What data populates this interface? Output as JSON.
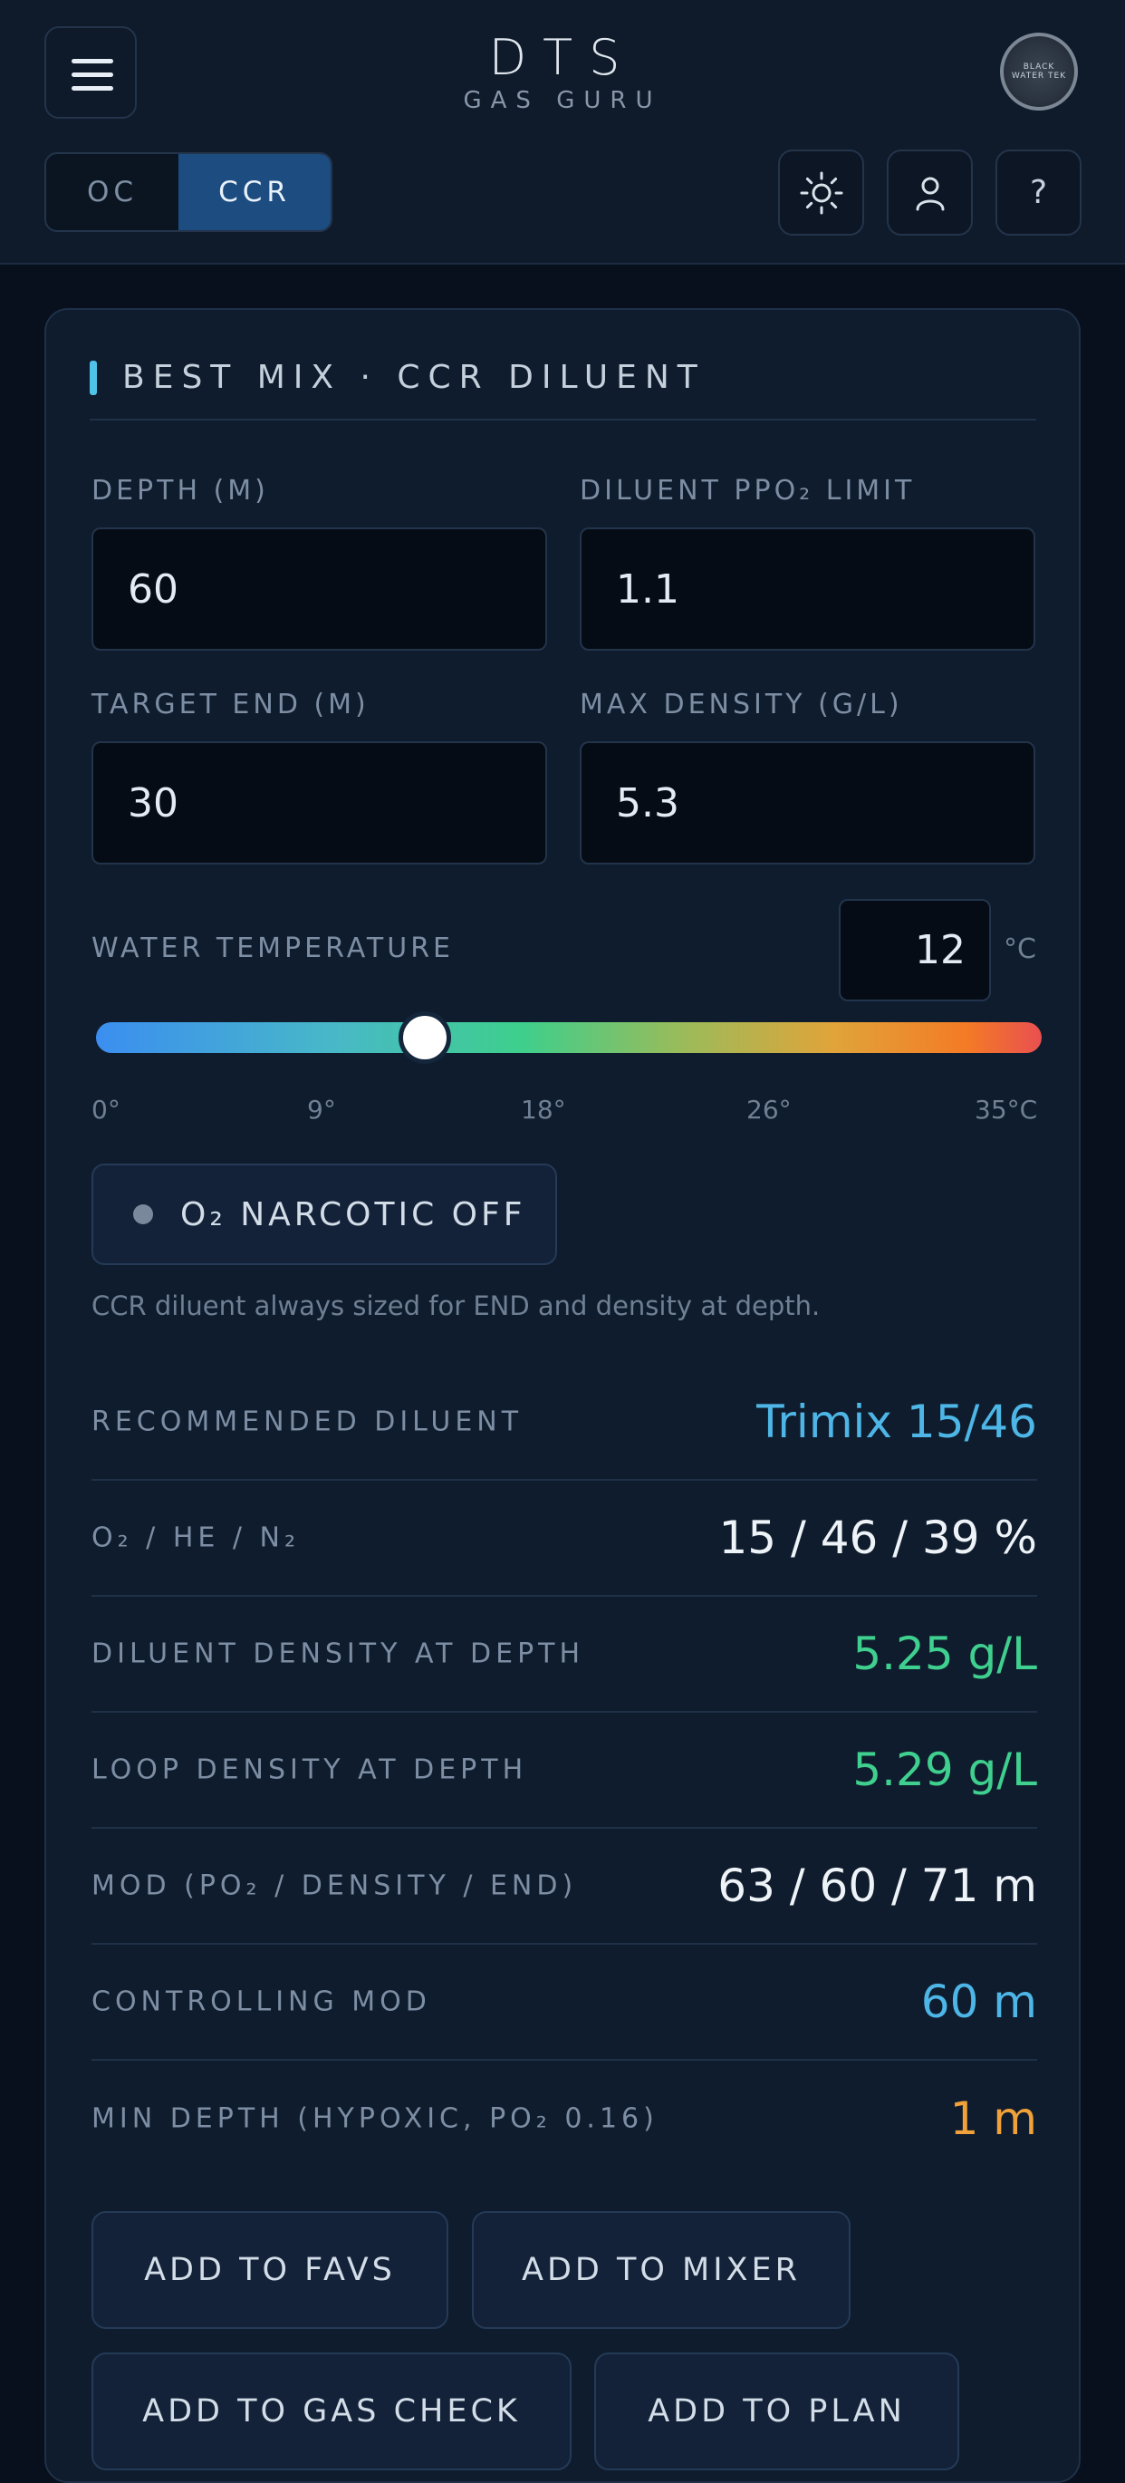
{
  "header": {
    "title": "DTS",
    "subtitle": "GAS GURU",
    "logo_text": "BLACK WATER TEK",
    "modes": [
      "OC",
      "CCR"
    ],
    "active_mode": "CCR",
    "help_label": "?"
  },
  "card": {
    "title": "BEST MIX · CCR DILUENT",
    "fields": {
      "depth": {
        "label": "DEPTH (M)",
        "value": "60"
      },
      "ppo2_limit": {
        "label": "DILUENT PPO₂ LIMIT",
        "value": "1.1"
      },
      "target_end": {
        "label": "TARGET END (M)",
        "value": "30"
      },
      "max_density": {
        "label": "MAX DENSITY (G/L)",
        "value": "5.3"
      }
    },
    "temperature": {
      "label": "WATER TEMPERATURE",
      "value": "12",
      "unit": "°C",
      "min": 0,
      "max": 35,
      "ticks": [
        "0°",
        "9°",
        "18°",
        "26°",
        "35°C"
      ]
    },
    "narcotic_toggle": "O₂ NARCOTIC OFF",
    "note": "CCR diluent always sized for END and density at depth.",
    "results": [
      {
        "label": "RECOMMENDED DILUENT",
        "value": "Trimix 15/46",
        "color": "#4db6e6"
      },
      {
        "label": "O₂ / HE / N₂",
        "value": "15 / 46 / 39 %",
        "color": "#eef3f8"
      },
      {
        "label": "DILUENT DENSITY AT DEPTH",
        "value": "5.25 g/L",
        "color": "#3fcf8e"
      },
      {
        "label": "LOOP DENSITY AT DEPTH",
        "value": "5.29 g/L",
        "color": "#3fcf8e"
      },
      {
        "label": "MOD (PO₂ / DENSITY / END)",
        "value": "63 / 60 / 71 m",
        "color": "#eef3f8"
      },
      {
        "label": "CONTROLLING MOD",
        "value": "60 m",
        "color": "#4db6e6"
      },
      {
        "label": "MIN DEPTH (HYPOXIC, PO₂ 0.16)",
        "value": "1 m",
        "color": "#f0a13a"
      }
    ],
    "actions": {
      "add_to_favs": "ADD TO FAVS",
      "add_to_mixer": "ADD TO MIXER",
      "add_to_gas_check": "ADD TO GAS CHECK",
      "add_to_plan": "ADD TO PLAN"
    }
  }
}
